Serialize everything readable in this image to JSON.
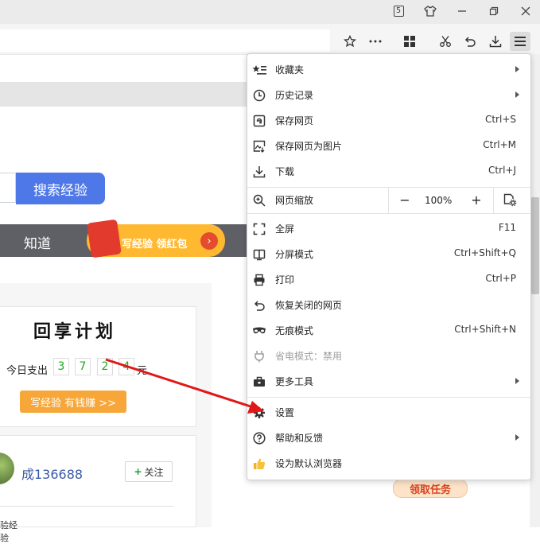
{
  "titlebar": {
    "tab_count": "5"
  },
  "page": {
    "search_button": "搜索经验",
    "nav_zhidao": "知道",
    "promo_text": "写经验 领红包",
    "card_title": "回享计划",
    "spend_label": "今日支出",
    "spend_digits": [
      "3",
      "7",
      "2",
      "4"
    ],
    "spend_unit": "元",
    "write_button": "写经验 有钱赚 >>",
    "username": "成136688",
    "follow_label": "关注",
    "task_button": "领取任务",
    "card2_foot": "验经验"
  },
  "menu": {
    "items": [
      {
        "label": "收藏夹",
        "icon": "favorites-list-icon",
        "shortcut": ""
      },
      {
        "label": "历史记录",
        "icon": "history-clock-icon",
        "shortcut": ""
      },
      {
        "label": "保存网页",
        "icon": "save-page-icon",
        "shortcut": "Ctrl+S"
      },
      {
        "label": "保存网页为图片",
        "icon": "save-image-icon",
        "shortcut": "Ctrl+M"
      },
      {
        "label": "下载",
        "icon": "download-icon",
        "shortcut": "Ctrl+J"
      },
      {
        "label": "网页缩放",
        "icon": "zoom-icon",
        "shortcut": ""
      },
      {
        "label": "全屏",
        "icon": "fullscreen-icon",
        "shortcut": "F11"
      },
      {
        "label": "分屏模式",
        "icon": "split-screen-icon",
        "shortcut": "Ctrl+Shift+Q"
      },
      {
        "label": "打印",
        "icon": "printer-icon",
        "shortcut": "Ctrl+P"
      },
      {
        "label": "恢复关闭的网页",
        "icon": "restore-icon",
        "shortcut": ""
      },
      {
        "label": "无痕模式",
        "icon": "incognito-mask-icon",
        "shortcut": "Ctrl+Shift+N"
      },
      {
        "label": "省电模式：禁用",
        "icon": "power-plug-icon",
        "shortcut": ""
      },
      {
        "label": "更多工具",
        "icon": "toolbox-icon",
        "shortcut": ""
      },
      {
        "label": "设置",
        "icon": "gear-icon",
        "shortcut": ""
      },
      {
        "label": "帮助和反馈",
        "icon": "help-icon",
        "shortcut": ""
      },
      {
        "label": "设为默认浏览器",
        "icon": "thumbs-up-icon",
        "shortcut": ""
      }
    ],
    "zoom": {
      "minus": "−",
      "value": "100%",
      "plus": "+"
    }
  },
  "colors": {
    "search_button": "#4e78e8",
    "promo": "#ffb931",
    "write_button": "#f7a739",
    "digit_green": "#22a622",
    "annotation_arrow": "#e01818"
  }
}
